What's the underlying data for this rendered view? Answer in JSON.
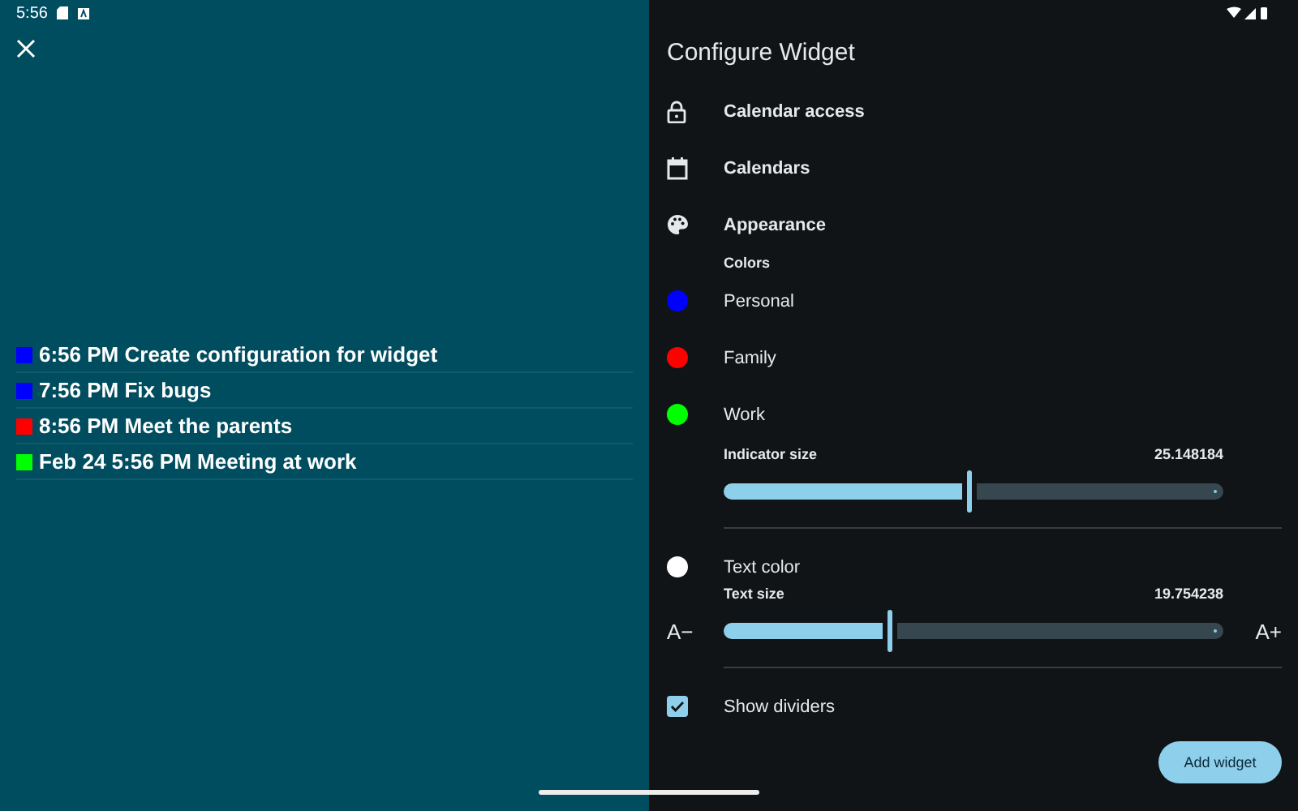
{
  "status_bar": {
    "time": "5:56"
  },
  "events": [
    {
      "text": "6:56 PM Create configuration for widget",
      "color": "#0000ff"
    },
    {
      "text": "7:56 PM Fix bugs",
      "color": "#0000ff"
    },
    {
      "text": "8:56 PM Meet the parents",
      "color": "#ff0000"
    },
    {
      "text": "Feb 24 5:56 PM Meeting at work",
      "color": "#00ff00"
    }
  ],
  "config": {
    "title": "Configure Widget",
    "sections": [
      {
        "kind": "lock",
        "label": "Calendar access"
      },
      {
        "kind": "calendar",
        "label": "Calendars"
      },
      {
        "kind": "palette",
        "label": "Appearance"
      }
    ],
    "colors_heading": "Colors",
    "colors": [
      {
        "name": "Personal",
        "color": "#0000ff"
      },
      {
        "name": "Family",
        "color": "#ff0000"
      },
      {
        "name": "Work",
        "color": "#00ff00"
      }
    ],
    "indicator_size": {
      "label": "Indicator size",
      "reading": "25.148184",
      "level": 0.49
    },
    "text_color": {
      "name": "Text color",
      "color": "#ffffff"
    },
    "text_size": {
      "label": "Text size",
      "reading": "19.754238",
      "level": 0.33,
      "decrease": "A−",
      "increase": "A+"
    },
    "show_dividers": {
      "label": "Show dividers",
      "checked": true
    },
    "button": "Add widget"
  }
}
